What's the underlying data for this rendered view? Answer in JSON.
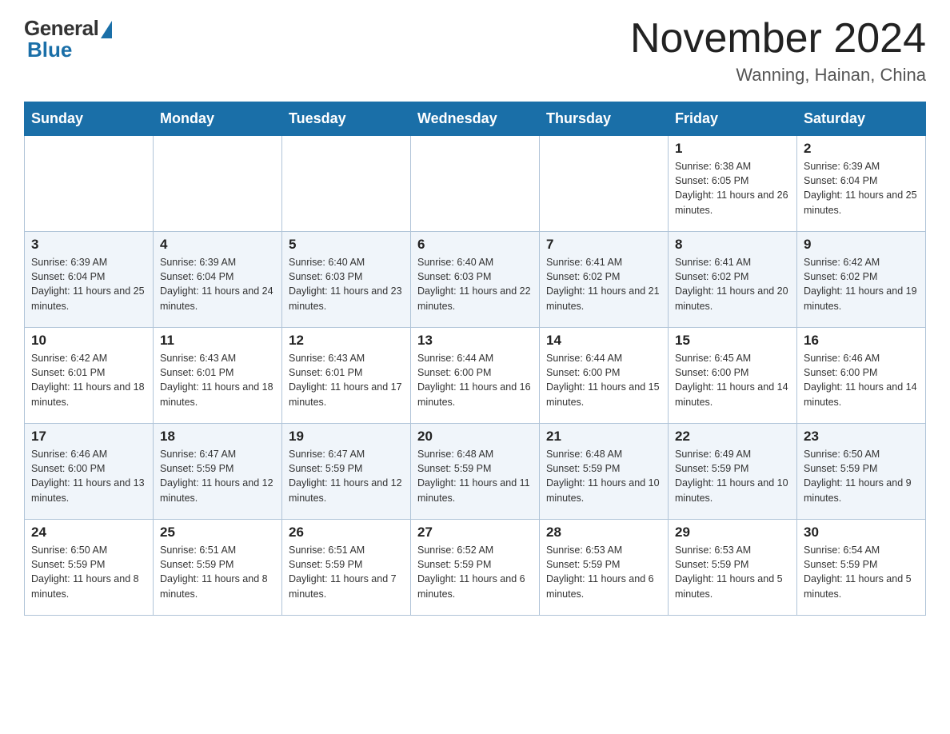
{
  "header": {
    "title": "November 2024",
    "location": "Wanning, Hainan, China",
    "logo_general": "General",
    "logo_blue": "Blue"
  },
  "days_of_week": [
    "Sunday",
    "Monday",
    "Tuesday",
    "Wednesday",
    "Thursday",
    "Friday",
    "Saturday"
  ],
  "weeks": [
    [
      {
        "day": "",
        "info": ""
      },
      {
        "day": "",
        "info": ""
      },
      {
        "day": "",
        "info": ""
      },
      {
        "day": "",
        "info": ""
      },
      {
        "day": "",
        "info": ""
      },
      {
        "day": "1",
        "info": "Sunrise: 6:38 AM\nSunset: 6:05 PM\nDaylight: 11 hours and 26 minutes."
      },
      {
        "day": "2",
        "info": "Sunrise: 6:39 AM\nSunset: 6:04 PM\nDaylight: 11 hours and 25 minutes."
      }
    ],
    [
      {
        "day": "3",
        "info": "Sunrise: 6:39 AM\nSunset: 6:04 PM\nDaylight: 11 hours and 25 minutes."
      },
      {
        "day": "4",
        "info": "Sunrise: 6:39 AM\nSunset: 6:04 PM\nDaylight: 11 hours and 24 minutes."
      },
      {
        "day": "5",
        "info": "Sunrise: 6:40 AM\nSunset: 6:03 PM\nDaylight: 11 hours and 23 minutes."
      },
      {
        "day": "6",
        "info": "Sunrise: 6:40 AM\nSunset: 6:03 PM\nDaylight: 11 hours and 22 minutes."
      },
      {
        "day": "7",
        "info": "Sunrise: 6:41 AM\nSunset: 6:02 PM\nDaylight: 11 hours and 21 minutes."
      },
      {
        "day": "8",
        "info": "Sunrise: 6:41 AM\nSunset: 6:02 PM\nDaylight: 11 hours and 20 minutes."
      },
      {
        "day": "9",
        "info": "Sunrise: 6:42 AM\nSunset: 6:02 PM\nDaylight: 11 hours and 19 minutes."
      }
    ],
    [
      {
        "day": "10",
        "info": "Sunrise: 6:42 AM\nSunset: 6:01 PM\nDaylight: 11 hours and 18 minutes."
      },
      {
        "day": "11",
        "info": "Sunrise: 6:43 AM\nSunset: 6:01 PM\nDaylight: 11 hours and 18 minutes."
      },
      {
        "day": "12",
        "info": "Sunrise: 6:43 AM\nSunset: 6:01 PM\nDaylight: 11 hours and 17 minutes."
      },
      {
        "day": "13",
        "info": "Sunrise: 6:44 AM\nSunset: 6:00 PM\nDaylight: 11 hours and 16 minutes."
      },
      {
        "day": "14",
        "info": "Sunrise: 6:44 AM\nSunset: 6:00 PM\nDaylight: 11 hours and 15 minutes."
      },
      {
        "day": "15",
        "info": "Sunrise: 6:45 AM\nSunset: 6:00 PM\nDaylight: 11 hours and 14 minutes."
      },
      {
        "day": "16",
        "info": "Sunrise: 6:46 AM\nSunset: 6:00 PM\nDaylight: 11 hours and 14 minutes."
      }
    ],
    [
      {
        "day": "17",
        "info": "Sunrise: 6:46 AM\nSunset: 6:00 PM\nDaylight: 11 hours and 13 minutes."
      },
      {
        "day": "18",
        "info": "Sunrise: 6:47 AM\nSunset: 5:59 PM\nDaylight: 11 hours and 12 minutes."
      },
      {
        "day": "19",
        "info": "Sunrise: 6:47 AM\nSunset: 5:59 PM\nDaylight: 11 hours and 12 minutes."
      },
      {
        "day": "20",
        "info": "Sunrise: 6:48 AM\nSunset: 5:59 PM\nDaylight: 11 hours and 11 minutes."
      },
      {
        "day": "21",
        "info": "Sunrise: 6:48 AM\nSunset: 5:59 PM\nDaylight: 11 hours and 10 minutes."
      },
      {
        "day": "22",
        "info": "Sunrise: 6:49 AM\nSunset: 5:59 PM\nDaylight: 11 hours and 10 minutes."
      },
      {
        "day": "23",
        "info": "Sunrise: 6:50 AM\nSunset: 5:59 PM\nDaylight: 11 hours and 9 minutes."
      }
    ],
    [
      {
        "day": "24",
        "info": "Sunrise: 6:50 AM\nSunset: 5:59 PM\nDaylight: 11 hours and 8 minutes."
      },
      {
        "day": "25",
        "info": "Sunrise: 6:51 AM\nSunset: 5:59 PM\nDaylight: 11 hours and 8 minutes."
      },
      {
        "day": "26",
        "info": "Sunrise: 6:51 AM\nSunset: 5:59 PM\nDaylight: 11 hours and 7 minutes."
      },
      {
        "day": "27",
        "info": "Sunrise: 6:52 AM\nSunset: 5:59 PM\nDaylight: 11 hours and 6 minutes."
      },
      {
        "day": "28",
        "info": "Sunrise: 6:53 AM\nSunset: 5:59 PM\nDaylight: 11 hours and 6 minutes."
      },
      {
        "day": "29",
        "info": "Sunrise: 6:53 AM\nSunset: 5:59 PM\nDaylight: 11 hours and 5 minutes."
      },
      {
        "day": "30",
        "info": "Sunrise: 6:54 AM\nSunset: 5:59 PM\nDaylight: 11 hours and 5 minutes."
      }
    ]
  ]
}
